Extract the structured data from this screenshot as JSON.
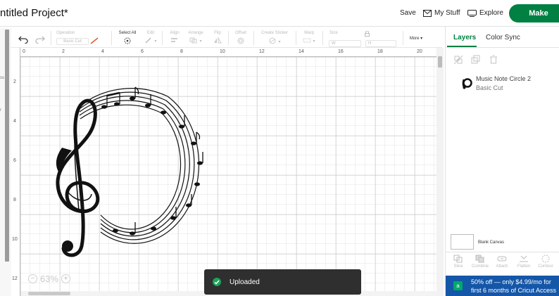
{
  "header": {
    "title": "ntitled Project*",
    "save_label": "Save",
    "mystuff_label": "My Stuff",
    "explore_label": "Explore",
    "make_label": "Make",
    "accent_color": "#008043"
  },
  "toolbar": {
    "operation_label": "Operation",
    "operation_value": "Basic Cut",
    "select_all_label": "Select All",
    "edit_label": "Edit",
    "align_label": "Align",
    "arrange_label": "Arrange",
    "flip_label": "Flip",
    "offset_label": "Offset",
    "create_sticker_label": "Create Sticker",
    "warp_label": "Warp",
    "size_label": "Size",
    "w_label": "W",
    "h_label": "H",
    "more_label": "More"
  },
  "ruler": {
    "top": [
      "0",
      "2",
      "4",
      "6",
      "8",
      "10",
      "12",
      "14",
      "16",
      "18",
      "20"
    ],
    "left": [
      "2",
      "4",
      "6",
      "8",
      "10",
      "12"
    ],
    "gutter_marks": [
      "ss",
      "r"
    ]
  },
  "canvas": {
    "zoom_minus": "−",
    "zoom_level": "63%",
    "zoom_plus": "+"
  },
  "toast": {
    "message": "Uploaded",
    "color": "#1ba35c"
  },
  "panel": {
    "tabs": [
      {
        "label": "Layers",
        "active": true
      },
      {
        "label": "Color Sync",
        "active": false
      }
    ],
    "layer": {
      "name": "Music Note Circle 2",
      "operation": "Basic Cut"
    },
    "blank_canvas_label": "Blank Canvas",
    "tools": [
      "Slice",
      "Combine",
      "Attach",
      "Flatten",
      "Contour"
    ],
    "promo_line1": "50% off — only $4.99/mo for",
    "promo_line2": "first 6 months of Cricut Access",
    "promo_icon": "a"
  }
}
